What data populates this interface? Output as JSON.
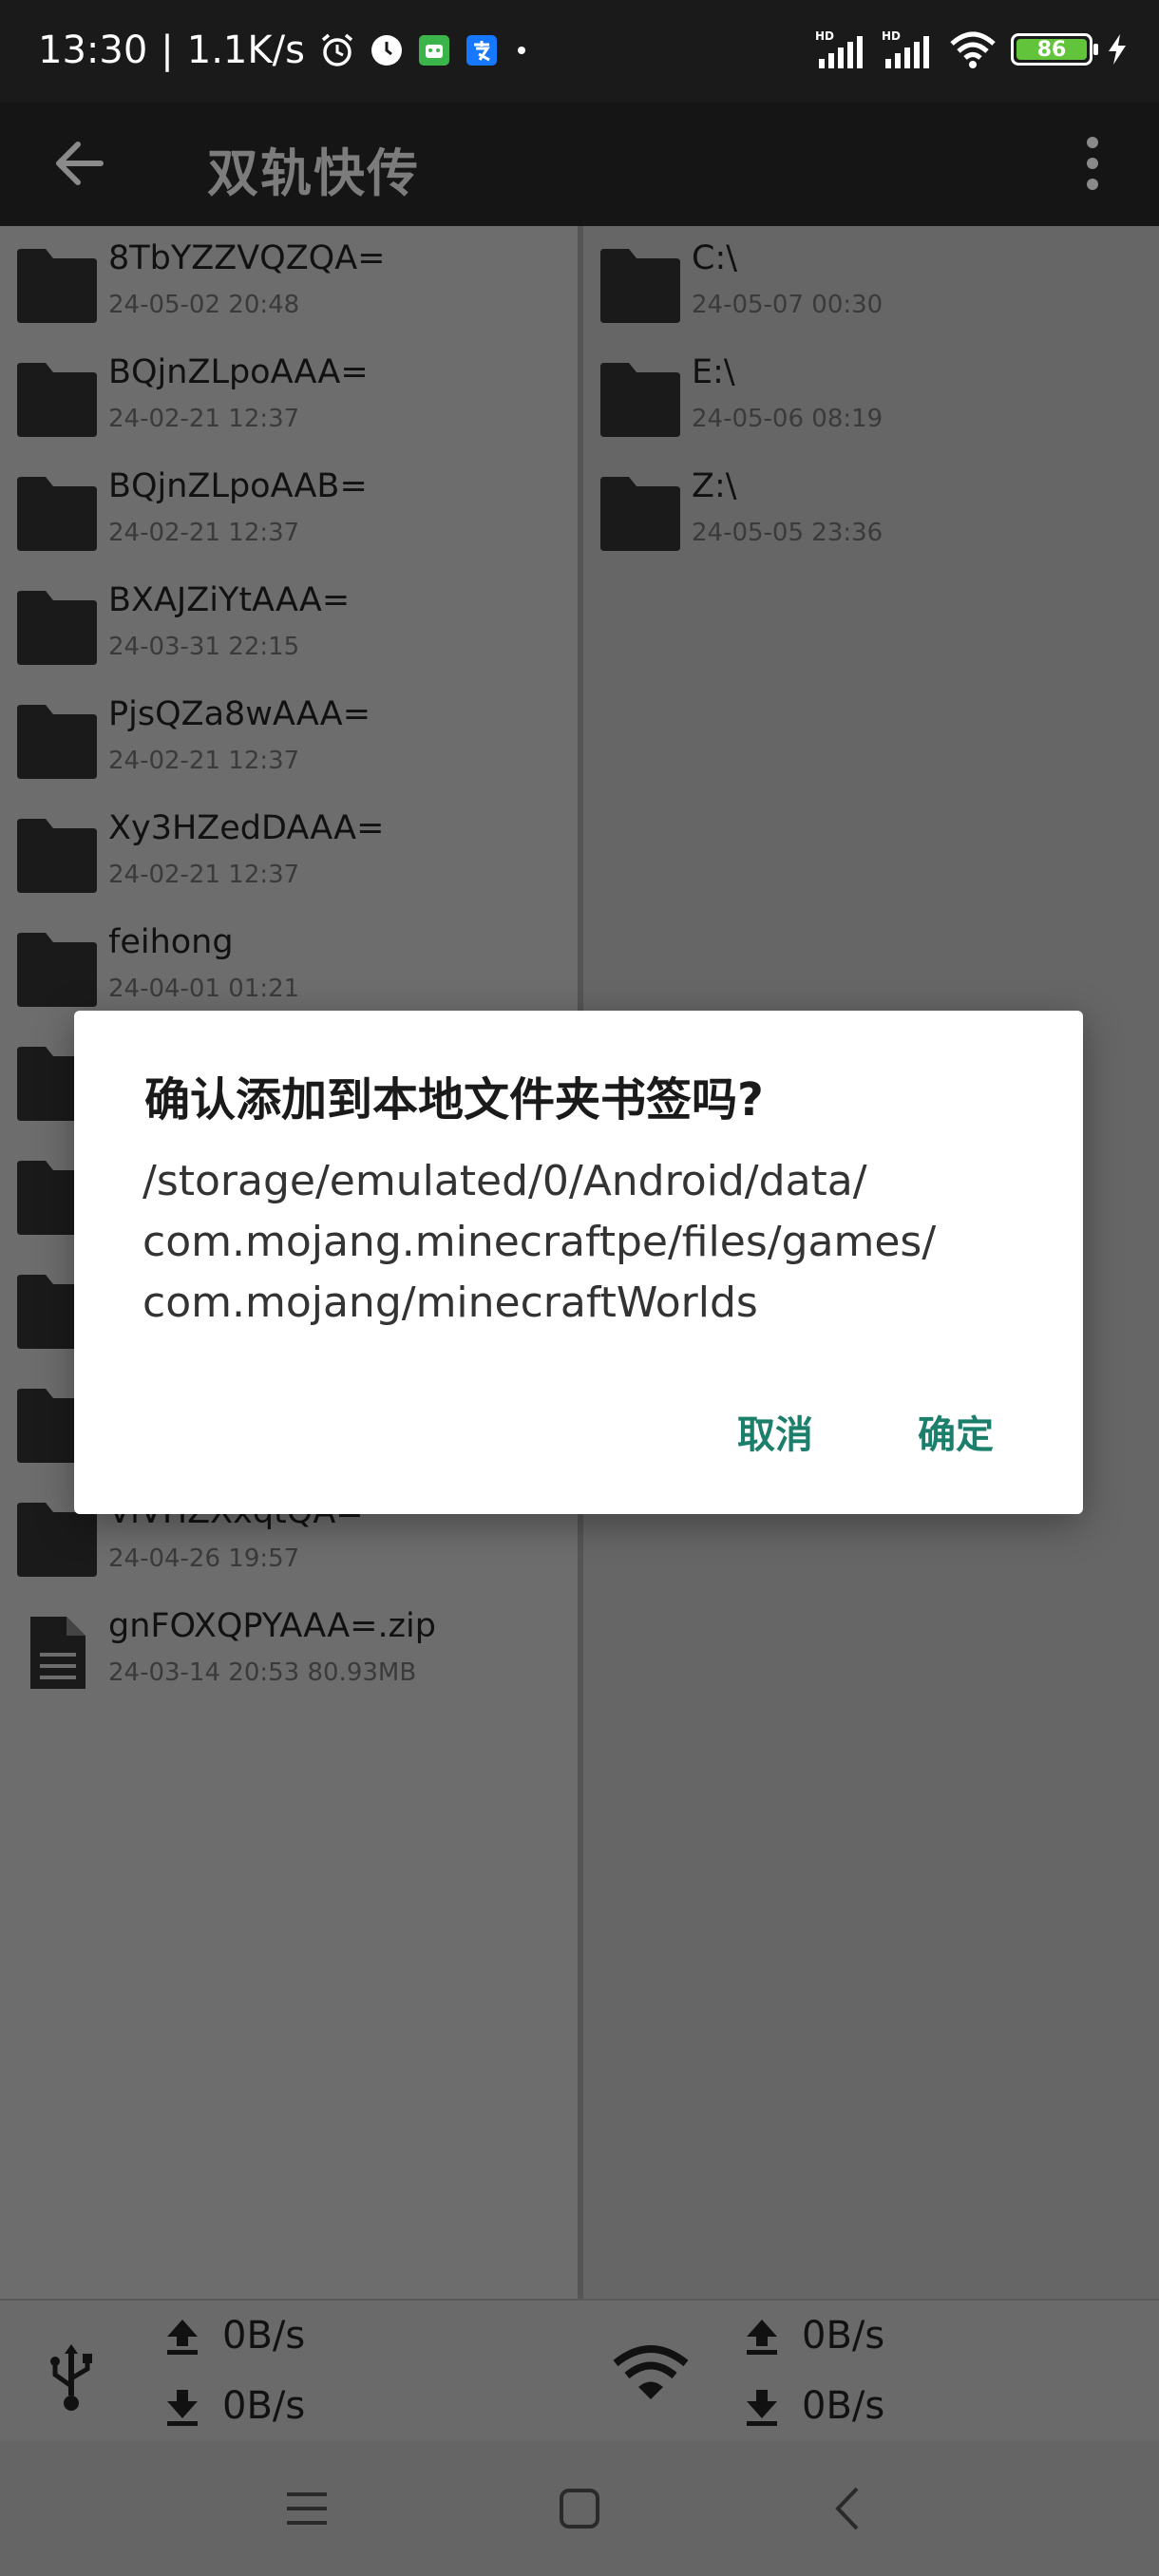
{
  "status_bar": {
    "time": "13:30",
    "separator": "|",
    "speed": "1.1K/s",
    "battery": "86"
  },
  "app_bar": {
    "title": "双轨快传"
  },
  "left_pane": {
    "items": [
      {
        "name": "8TbYZZVQZQA=",
        "meta": "24-05-02 20:48",
        "type": "folder"
      },
      {
        "name": "BQjnZLpoAAA=",
        "meta": "24-02-21 12:37",
        "type": "folder"
      },
      {
        "name": "BQjnZLpoAAB=",
        "meta": "24-02-21 12:37",
        "type": "folder"
      },
      {
        "name": "BXAJZiYtAAA=",
        "meta": "24-03-31 22:15",
        "type": "folder"
      },
      {
        "name": "PjsQZa8wAAA=",
        "meta": "24-02-21 12:37",
        "type": "folder"
      },
      {
        "name": "Xy3HZedDAAA=",
        "meta": "24-02-21 12:37",
        "type": "folder"
      },
      {
        "name": "feihong",
        "meta": "24-04-01 01:21",
        "type": "folder"
      },
      {
        "name": "ViVHZXxqtQA=",
        "meta": "24-04-26 19:57",
        "type": "folder"
      },
      {
        "name": "gnFOXQPYAAA=.zip",
        "meta": "24-03-14 20:53 80.93MB",
        "type": "file"
      }
    ]
  },
  "right_pane": {
    "items": [
      {
        "name": "C:\\",
        "meta": "24-05-07 00:30",
        "type": "folder"
      },
      {
        "name": "E:\\",
        "meta": "24-05-06 08:19",
        "type": "folder"
      },
      {
        "name": "Z:\\",
        "meta": "24-05-05 23:36",
        "type": "folder"
      }
    ]
  },
  "speed_bar": {
    "usb_upload": "0B/s",
    "usb_download": "0B/s",
    "wifi_upload": "0B/s",
    "wifi_download": "0B/s"
  },
  "dialog": {
    "title": "确认添加到本地文件夹书签吗?",
    "message_line1": "/storage/emulated/0/Android/data/",
    "message_line2": "com.mojang.minecraftpe/files/games/",
    "message_line3": "com.mojang/minecraftWorlds",
    "cancel_label": "取消",
    "confirm_label": "确定"
  },
  "colors": {
    "accent": "#1b7f6c",
    "battery": "#62c43a"
  }
}
